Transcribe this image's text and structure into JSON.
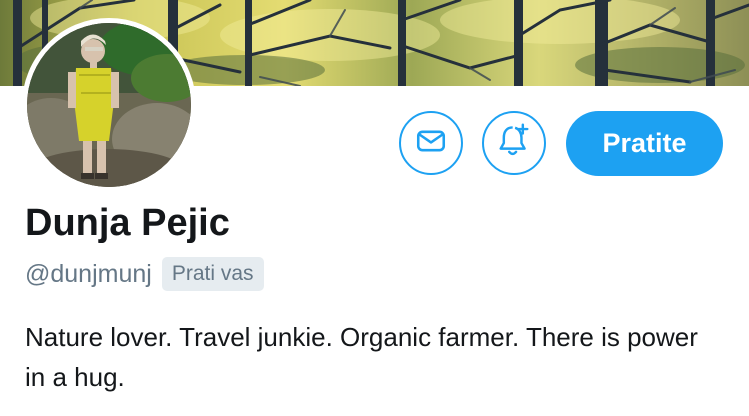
{
  "profile": {
    "display_name": "Dunja Pejic",
    "handle": "@dunjmunj",
    "follows_you_badge": "Prati vas",
    "bio": "Nature lover. Travel junkie. Organic farmer. There is power in a hug."
  },
  "actions": {
    "message_icon": "envelope-icon",
    "notifications_icon": "bell-plus-icon",
    "follow_label": "Pratite"
  },
  "colors": {
    "accent": "#1da1f2",
    "text_primary": "#14171a",
    "text_secondary": "#657786",
    "badge_background": "#e6ecf0"
  }
}
